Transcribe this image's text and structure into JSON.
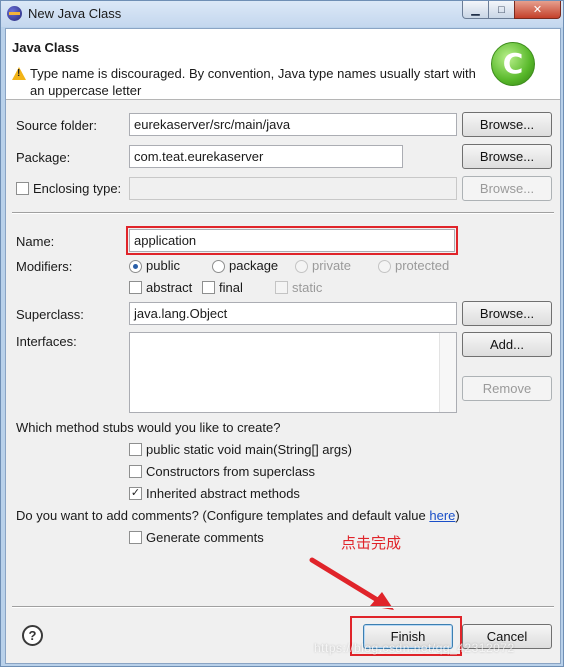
{
  "window": {
    "title": "New Java Class",
    "controls": {
      "minimize": "▁",
      "maximize": "□",
      "close": "✕"
    }
  },
  "header": {
    "title": "Java Class",
    "message": "Type name is discouraged. By convention, Java type names usually start with an uppercase letter",
    "logo_glyph": "C"
  },
  "form": {
    "source_folder": {
      "label": "Source folder:",
      "value": "eurekaserver/src/main/java",
      "button": "Browse..."
    },
    "package": {
      "label": "Package:",
      "value": "com.teat.eurekaserver",
      "button": "Browse..."
    },
    "enclosing_type": {
      "label": "Enclosing type:",
      "value": "",
      "button": "Browse...",
      "checked": false
    },
    "name": {
      "label": "Name:",
      "value": "application"
    },
    "modifiers": {
      "label": "Modifiers:",
      "access": [
        "public",
        "package",
        "private",
        "protected"
      ],
      "selected": "public",
      "flags": [
        "abstract",
        "final",
        "static"
      ]
    },
    "superclass": {
      "label": "Superclass:",
      "value": "java.lang.Object",
      "button": "Browse..."
    },
    "interfaces": {
      "label": "Interfaces:",
      "add_button": "Add...",
      "remove_button": "Remove"
    }
  },
  "stubs": {
    "question": "Which method stubs would you like to create?",
    "options": [
      {
        "label": "public static void main(String[] args)",
        "checked": false
      },
      {
        "label": "Constructors from superclass",
        "checked": false
      },
      {
        "label": "Inherited abstract methods",
        "checked": true
      }
    ]
  },
  "comments": {
    "question": "Do you want to add comments? (Configure templates and default value ",
    "link": "here",
    "closing": ")",
    "option": {
      "label": "Generate comments",
      "checked": false
    }
  },
  "annotation": {
    "text": "点击完成"
  },
  "footer": {
    "help": "?",
    "finish": "Finish",
    "cancel": "Cancel"
  },
  "watermark": "https://blog.csdn.net/qq_42312072",
  "colors": {
    "highlight": "#e0242a",
    "link": "#1a4fc8",
    "checkmark": "✓"
  }
}
